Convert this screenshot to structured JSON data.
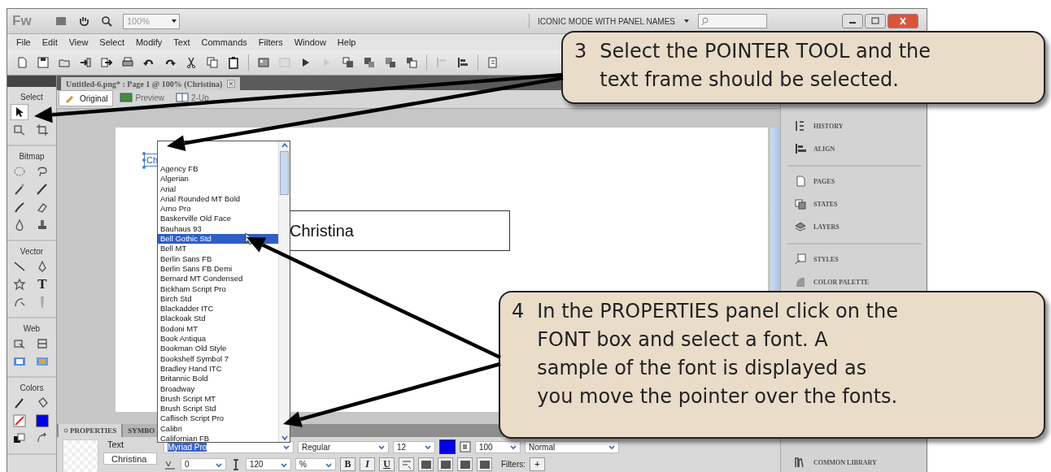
{
  "window": {
    "logo": "Fw",
    "zoom": "100%",
    "workspace": "ICONIC MODE WITH PANEL NAMES"
  },
  "menu": [
    "File",
    "Edit",
    "View",
    "Select",
    "Modify",
    "Text",
    "Commands",
    "Filters",
    "Window",
    "Help"
  ],
  "document_tab": {
    "title": "Untitled-6.png* : Page 1 @ 100% (Christina)"
  },
  "view_tabs": [
    {
      "label": "Original",
      "kind": "original",
      "selected": true
    },
    {
      "label": "Preview",
      "kind": "preview",
      "selected": false
    },
    {
      "label": "2-Up",
      "kind": "twoup",
      "selected": false
    }
  ],
  "tools": [
    {
      "label": "Select",
      "tools": [
        {
          "kind": "pointer",
          "selected": true
        },
        {
          "kind": "scale",
          "selected": false
        },
        {
          "kind": "crop",
          "selected": false
        }
      ]
    },
    {
      "label": "Bitmap",
      "tools": [
        {
          "kind": "marquee",
          "selected": false
        },
        {
          "kind": "lasso",
          "selected": false
        },
        {
          "kind": "wand",
          "selected": false
        },
        {
          "kind": "brush",
          "selected": false
        },
        {
          "kind": "pencil",
          "selected": false
        },
        {
          "kind": "eraser",
          "selected": false
        },
        {
          "kind": "blur",
          "selected": false
        },
        {
          "kind": "stamp",
          "selected": false
        }
      ]
    },
    {
      "label": "Vector",
      "tools": [
        {
          "kind": "line",
          "selected": false
        },
        {
          "kind": "pen",
          "selected": false
        },
        {
          "kind": "shape",
          "selected": false
        },
        {
          "kind": "text",
          "label": "T",
          "selected": false
        },
        {
          "kind": "freeform",
          "selected": false
        },
        {
          "kind": "knife",
          "selected": false
        }
      ]
    },
    {
      "label": "Web",
      "tools": [
        {
          "kind": "hotspot",
          "selected": false
        },
        {
          "kind": "slice",
          "selected": false
        },
        {
          "kind": "hideslices",
          "selected": false
        },
        {
          "kind": "showslices",
          "selected": false
        }
      ]
    },
    {
      "label": "Colors",
      "tools": [
        {
          "kind": "strokepen",
          "selected": false
        },
        {
          "kind": "bucket",
          "selected": false
        },
        {
          "kind": "strokeswatch",
          "selected": false
        },
        {
          "kind": "fillswatch",
          "selected": false
        },
        {
          "kind": "defaults",
          "selected": false
        },
        {
          "kind": "swap",
          "selected": false
        }
      ]
    }
  ],
  "canvas": {
    "text_object": "Ch",
    "box_text": "Christina"
  },
  "font_list": {
    "items": [
      {
        "label": "Agency FB",
        "selected": false
      },
      {
        "label": "Algerian",
        "selected": false
      },
      {
        "label": "Arial",
        "selected": false
      },
      {
        "label": "Arial Rounded MT Bold",
        "selected": false
      },
      {
        "label": "Arno Pro",
        "selected": false
      },
      {
        "label": "Baskerville Old Face",
        "selected": false
      },
      {
        "label": "Bauhaus 93",
        "selected": false
      },
      {
        "label": "Bell Gothic Std",
        "selected": true
      },
      {
        "label": "Bell MT",
        "selected": false
      },
      {
        "label": "Berlin Sans FB",
        "selected": false
      },
      {
        "label": "Berlin Sans FB Demi",
        "selected": false
      },
      {
        "label": "Bernard MT Condensed",
        "selected": false
      },
      {
        "label": "Bickham Script Pro",
        "selected": false
      },
      {
        "label": "Birch Std",
        "selected": false
      },
      {
        "label": "Blackadder ITC",
        "selected": false
      },
      {
        "label": "Blackoak Std",
        "selected": false
      },
      {
        "label": "Bodoni MT",
        "selected": false
      },
      {
        "label": "Book Antiqua",
        "selected": false
      },
      {
        "label": "Bookman Old Style",
        "selected": false
      },
      {
        "label": "Bookshelf Symbol 7",
        "selected": false
      },
      {
        "label": "Bradley Hand ITC",
        "selected": false
      },
      {
        "label": "Britannic Bold",
        "selected": false
      },
      {
        "label": "Broadway",
        "selected": false
      },
      {
        "label": "Brush Script MT",
        "selected": false
      },
      {
        "label": "Brush Script Std",
        "selected": false
      },
      {
        "label": "Caflisch Script Pro",
        "selected": false
      },
      {
        "label": "Calibri",
        "selected": false
      },
      {
        "label": "Californian FB",
        "selected": false
      }
    ]
  },
  "properties": {
    "tabs": [
      {
        "label": "PROPERTIES",
        "selected": true
      },
      {
        "label": "SYMBO",
        "selected": false
      }
    ],
    "object_type": "Text",
    "object_name": "Christina",
    "font": "Myriad Pro",
    "style": "Regular",
    "size": "12",
    "opacity": "100",
    "blend": "Normal",
    "kerning": "0",
    "leading": "120",
    "leading_unit": "%",
    "bold": "B",
    "italic": "I",
    "underline": "U",
    "filters_label": "Filters:",
    "add_filter": "+"
  },
  "panels": [
    {
      "items": [
        {
          "label": "HISTORY",
          "kind": "history"
        },
        {
          "label": "ALIGN",
          "kind": "align"
        }
      ]
    },
    {
      "items": [
        {
          "label": "PAGES",
          "kind": "pages"
        },
        {
          "label": "STATES",
          "kind": "states"
        },
        {
          "label": "LAYERS",
          "kind": "layers"
        }
      ]
    },
    {
      "items": [
        {
          "label": "STYLES",
          "kind": "styles"
        },
        {
          "label": "COLOR PALETTE",
          "kind": "palette"
        }
      ]
    },
    {
      "items": [
        {
          "label": "COMMON LIBRARY",
          "kind": "library"
        }
      ]
    }
  ],
  "callouts": [
    {
      "number": "3",
      "text": "Select the POINTER TOOL and the text frame should be selected."
    },
    {
      "number": "4",
      "text": "In the PROPERTIES panel click on the FONT box and select a font. A sample of the font is displayed as you move the pointer over the fonts."
    }
  ]
}
